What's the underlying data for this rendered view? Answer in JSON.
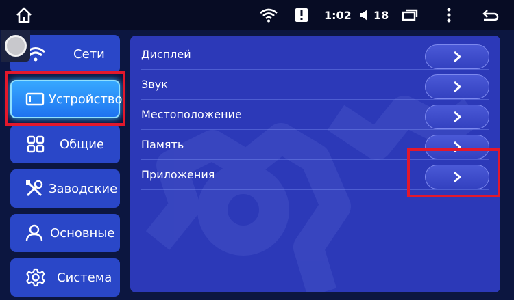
{
  "statusbar": {
    "time": "1:02",
    "volume": "18",
    "icons": [
      "home-icon",
      "wifi-icon",
      "alert-icon",
      "volume-icon",
      "recent-apps-icon",
      "more-icon",
      "back-icon"
    ]
  },
  "sidebar": {
    "items": [
      {
        "label": "Сети",
        "icon": "wifi-icon"
      },
      {
        "label": "Устройство",
        "icon": "device-icon",
        "active": true
      },
      {
        "label": "Общие",
        "icon": "grid-icon"
      },
      {
        "label": "Заводские",
        "icon": "tools-icon"
      },
      {
        "label": "Основные",
        "icon": "user-icon"
      },
      {
        "label": "Система",
        "icon": "gear-icon"
      }
    ]
  },
  "main": {
    "rows": [
      {
        "label": "Дисплей"
      },
      {
        "label": "Звук"
      },
      {
        "label": "Местоположение"
      },
      {
        "label": "Память"
      },
      {
        "label": "Приложения"
      }
    ]
  },
  "colors": {
    "background": "#0c1640",
    "panel": "#2c39b8",
    "sidebar_button": "#2a47c8",
    "active_button": "#1e73f0",
    "highlight": "#e3182c"
  }
}
